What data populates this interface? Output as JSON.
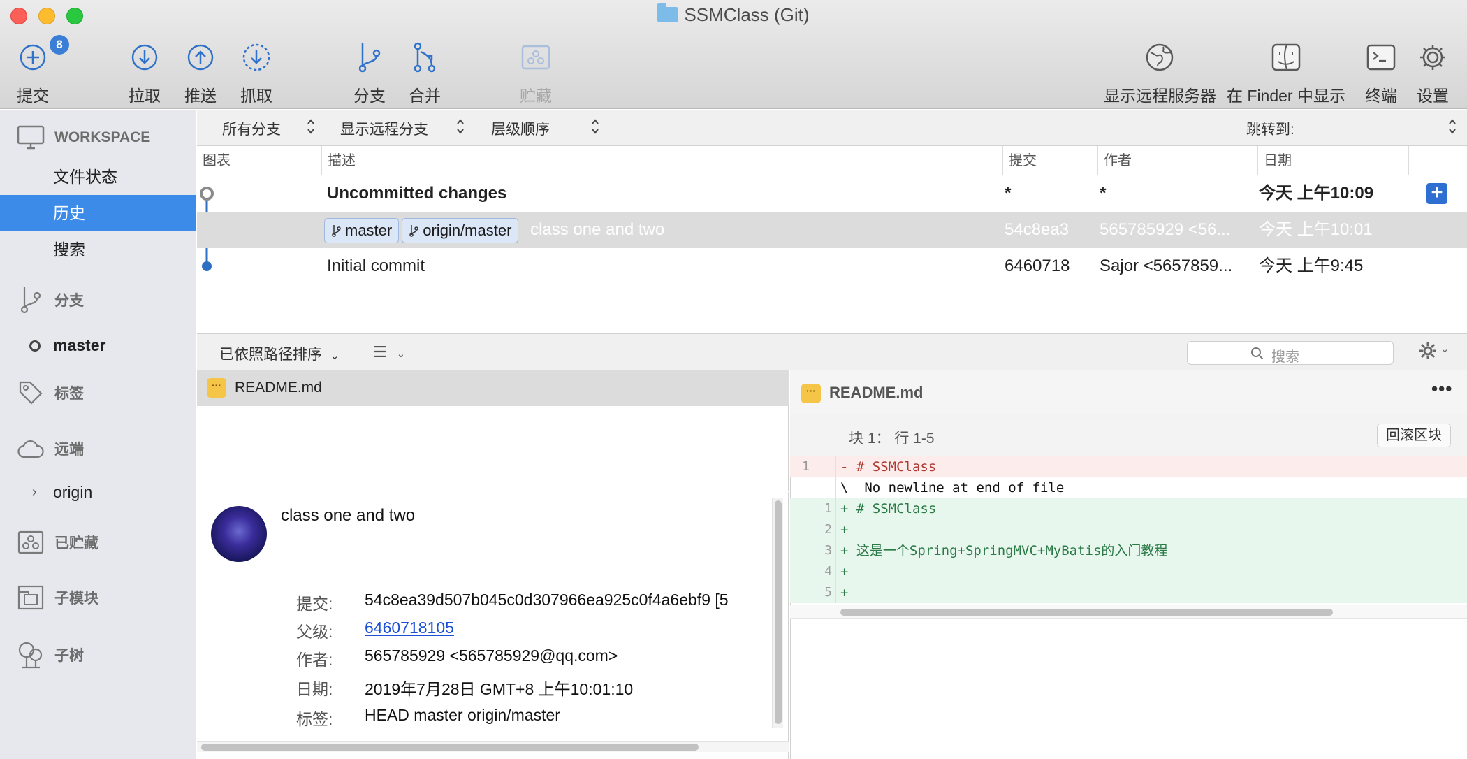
{
  "window": {
    "title": "SSMClass (Git)"
  },
  "toolbar": {
    "commit_label": "提交",
    "commit_badge": "8",
    "pull_label": "拉取",
    "push_label": "推送",
    "fetch_label": "抓取",
    "branch_label": "分支",
    "merge_label": "合并",
    "stash_label": "贮藏",
    "remote_label": "显示远程服务器",
    "finder_label": "在 Finder 中显示",
    "terminal_label": "终端",
    "settings_label": "设置"
  },
  "sidebar": {
    "workspace": "WORKSPACE",
    "file_status": "文件状态",
    "history": "历史",
    "search": "搜索",
    "branches": "分支",
    "current_branch": "master",
    "tags": "标签",
    "remotes": "远端",
    "remote_origin": "origin",
    "stashes": "已贮藏",
    "submodules": "子模块",
    "subtrees": "子树"
  },
  "filters": {
    "branches": "所有分支",
    "remote_branches": "显示远程分支",
    "order": "层级顺序",
    "jump_to": "跳转到:"
  },
  "table": {
    "headers": {
      "graph": "图表",
      "description": "描述",
      "commit": "提交",
      "author": "作者",
      "date": "日期"
    },
    "rows": [
      {
        "description": "Uncommitted changes",
        "commit": "*",
        "author": "*",
        "date": "今天 上午10:09"
      },
      {
        "tags": [
          "master",
          "origin/master"
        ],
        "description": "class one and two",
        "commit": "54c8ea3",
        "author": "565785929 <56...",
        "date": "今天 上午10:01"
      },
      {
        "description": "Initial commit",
        "commit": "6460718",
        "author": "Sajor <5657859...",
        "date": "今天 上午9:45"
      }
    ]
  },
  "lowerbar": {
    "sort": "已依照路径排序",
    "search_placeholder": "搜索"
  },
  "files": [
    {
      "name": "README.md"
    }
  ],
  "commit_detail": {
    "message": "class one and two",
    "commit_label": "提交:",
    "commit_value": "54c8ea39d507b045c0d307966ea925c0f4a6ebf9 [5",
    "parent_label": "父级:",
    "parent_value": "6460718105",
    "author_label": "作者:",
    "author_value": "565785929 <565785929@qq.com>",
    "date_label": "日期:",
    "date_value": "2019年7月28日 GMT+8 上午10:01:10",
    "tags_label": "标签:",
    "tags_value": "HEAD master origin/master"
  },
  "diff": {
    "file": "README.md",
    "hunk": "块 1： 行 1-5",
    "revert": "回滚区块",
    "lines": [
      {
        "old": "1",
        "new": "",
        "type": "del",
        "text": "- # SSMClass"
      },
      {
        "old": "",
        "new": "",
        "type": "note",
        "text": "\\  No newline at end of file"
      },
      {
        "old": "",
        "new": "1",
        "type": "add",
        "text": "+ # SSMClass"
      },
      {
        "old": "",
        "new": "2",
        "type": "add",
        "text": "+"
      },
      {
        "old": "",
        "new": "3",
        "type": "add",
        "text": "+ 这是一个Spring+SpringMVC+MyBatis的入门教程"
      },
      {
        "old": "",
        "new": "4",
        "type": "add",
        "text": "+"
      },
      {
        "old": "",
        "new": "5",
        "type": "add",
        "text": "+"
      }
    ]
  },
  "colors": {
    "accent": "#3d8be8",
    "graph": "#2e6fc4",
    "link": "#1a4fd6",
    "added": "#e8f7ee",
    "removed": "#fdecec"
  }
}
